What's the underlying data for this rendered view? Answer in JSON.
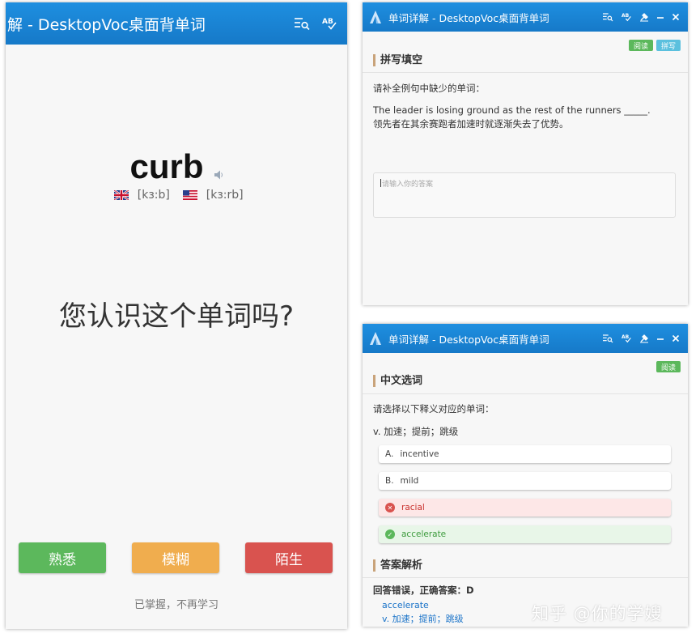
{
  "left_window": {
    "title": "解 - DesktopVoc桌面背单词",
    "word": "curb",
    "uk_phonetic": "[kɜ:b]",
    "us_phonetic": "[kɜ:rb]",
    "question": "您认识这个单词吗?",
    "buttons": {
      "familiar": "熟悉",
      "vague": "模糊",
      "strange": "陌生"
    },
    "mastered_hint": "已掌握，不再学习"
  },
  "right_top_window": {
    "title": "单词详解 - DesktopVoc桌面背单词",
    "tag_read": "阅读",
    "tag_spell": "拼写",
    "section_title": "拼写填空",
    "instruction": "请补全例句中缺少的单词：",
    "sentence_en": "The leader is losing ground as the rest of the runners _____.",
    "sentence_cn": "领先者在其余赛跑者加速时就逐渐失去了优势。",
    "answer_placeholder": "请输入你的答案"
  },
  "right_bottom_window": {
    "title": "单词详解 - DesktopVoc桌面背单词",
    "tag_read": "阅读",
    "section_title": "中文选词",
    "instruction": "请选择以下释义对应的单词：",
    "definition": "v. 加速；提前；跳级",
    "options": [
      {
        "letter": "A.",
        "text": "incentive",
        "state": "normal"
      },
      {
        "letter": "B.",
        "text": "mild",
        "state": "normal"
      },
      {
        "letter": "",
        "text": "racial",
        "state": "wrong"
      },
      {
        "letter": "",
        "text": "accelerate",
        "state": "correct"
      }
    ],
    "analysis_title": "答案解析",
    "result": "回答错误，正确答案：D",
    "answer_word": "accelerate",
    "answer_definition": "v. 加速；提前；跳级"
  },
  "watermark": "知乎 @你的学嫂",
  "colors": {
    "titlebar": "#1679c8",
    "green": "#5cb85c",
    "orange": "#f0ad4e",
    "red": "#d9534f",
    "blue_tag": "#5bc0de",
    "link": "#1a73c8"
  },
  "icons": [
    "list-search-icon",
    "spellcheck-icon",
    "pin-icon",
    "minimize-icon",
    "close-icon",
    "speaker-icon",
    "uk-flag-icon",
    "us-flag-icon",
    "app-logo-icon"
  ]
}
